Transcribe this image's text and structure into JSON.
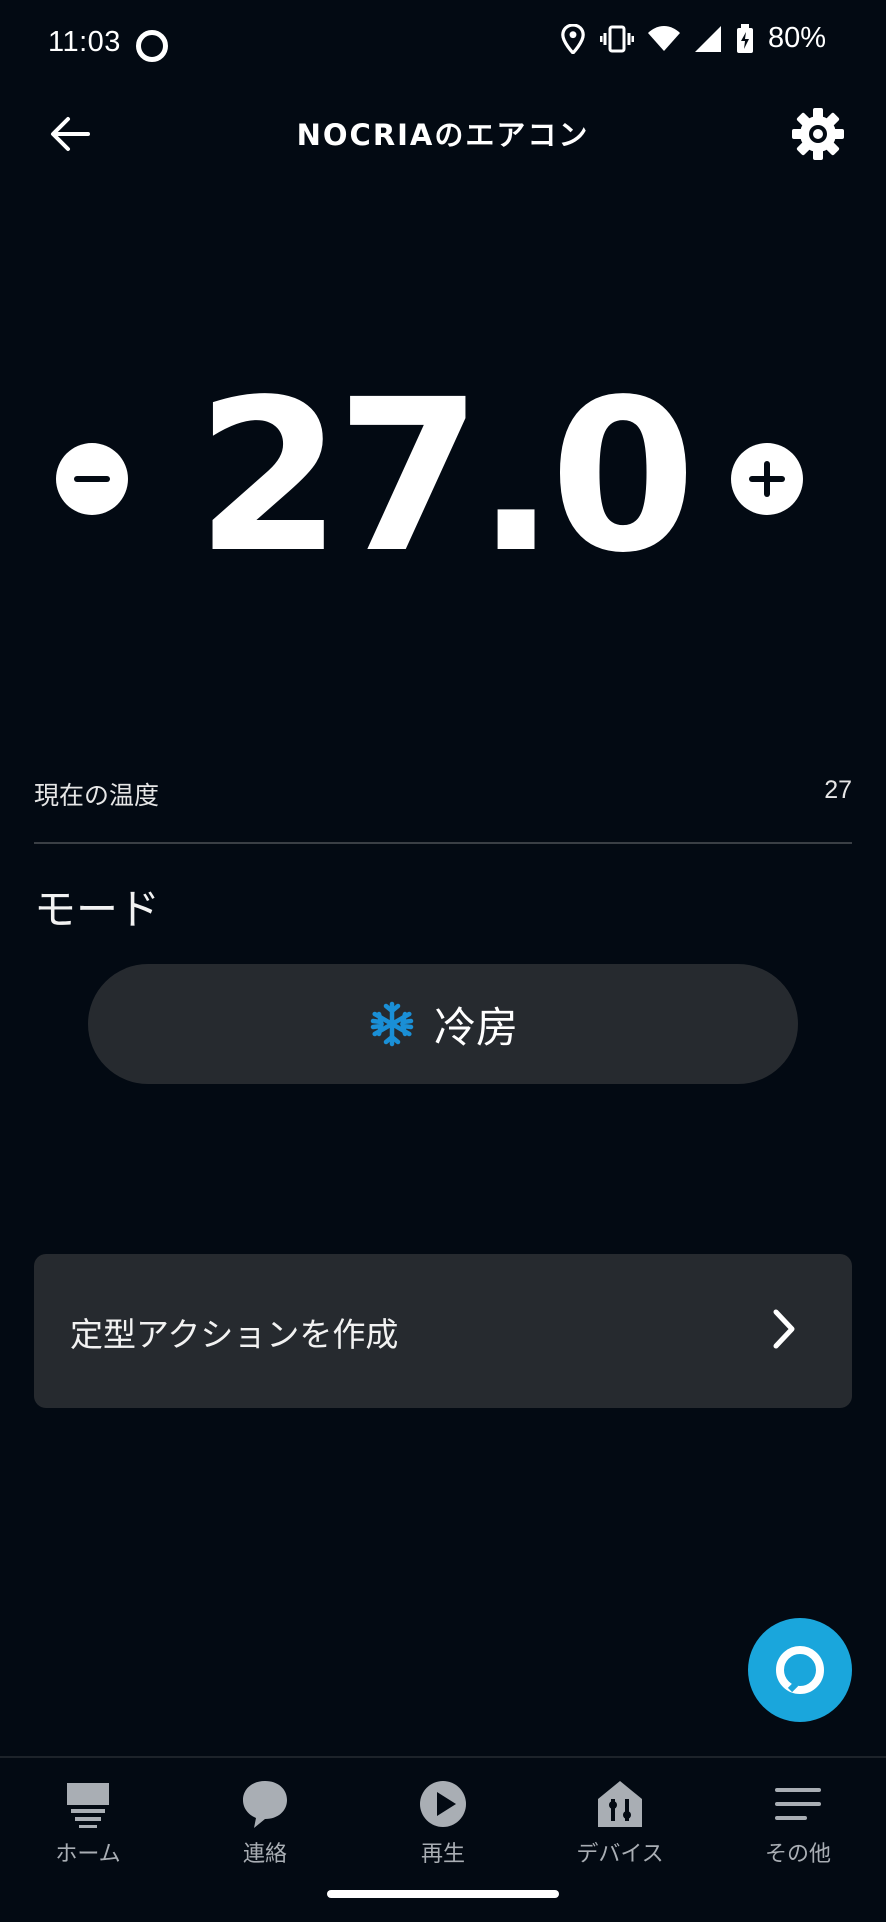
{
  "status_bar": {
    "time": "11:03",
    "battery": "80%"
  },
  "header": {
    "title": "NOCRIAのエアコン"
  },
  "thermostat": {
    "setpoint": "27.0"
  },
  "current_temp": {
    "label": "現在の温度",
    "value": "27"
  },
  "mode": {
    "label": "モード",
    "value": "冷房",
    "icon": "snowflake-icon",
    "icon_color": "#1a8fd6"
  },
  "routine": {
    "label": "定型アクションを作成"
  },
  "nav": {
    "items": [
      {
        "label": "ホーム",
        "icon": "home-icon"
      },
      {
        "label": "連絡",
        "icon": "chat-icon"
      },
      {
        "label": "再生",
        "icon": "play-icon"
      },
      {
        "label": "デバイス",
        "icon": "devices-icon"
      },
      {
        "label": "その他",
        "icon": "menu-icon"
      }
    ]
  },
  "colors": {
    "background": "#030a13",
    "card": "#262a2f",
    "alexa": "#1aa6dc"
  }
}
